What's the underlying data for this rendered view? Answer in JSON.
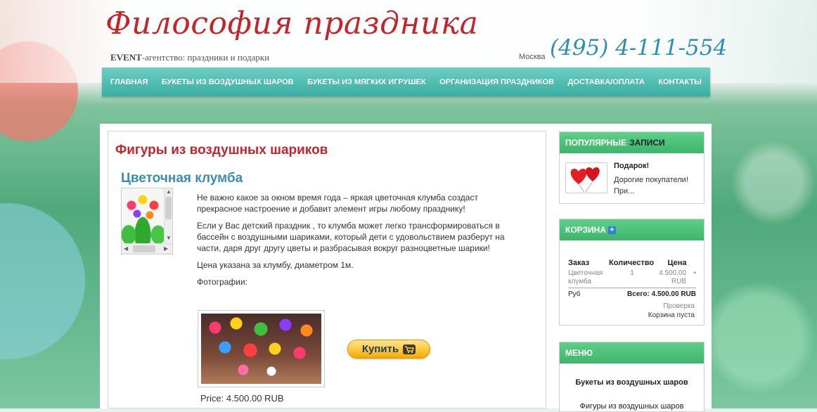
{
  "header": {
    "logo_title": "Философия праздника",
    "logo_sub_bold": "EVENT",
    "logo_sub_rest": "-агентство: праздники и подарки",
    "phone_city": "Москва",
    "phone_number": "(495) 4-111-554"
  },
  "nav": {
    "items": [
      "ГЛАВНАЯ",
      "БУКЕТЫ ИЗ ВОЗДУШНЫХ ШАРОВ",
      "БУКЕТЫ ИЗ МЯГКИХ ИГРУШЕК",
      "ОРГАНИЗАЦИЯ ПРАЗДНИКОВ",
      "ДОСТАВКА/ОПЛАТА",
      "КОНТАКТЫ"
    ]
  },
  "content": {
    "category_title": "Фигуры из воздушных шариков",
    "article_title": "Цветочная клумба",
    "paragraphs": [
      "Не важно какое за окном время года – яркая цветочная клумба создаст прекрасное настроение и добавит элемент игры любому празднику!",
      "Если у Вас детский праздник , то клумба может легко трансформироваться в бассейн с воздушными шариками, который дети с удовольствием разберут на части, даря друг другу цветы и разбрасывая вокруг разноцветные шарики!",
      "Цена указана за клумбу, диаметром 1м.",
      "Фотографии:"
    ],
    "buy_label": "Купить",
    "price": "Price: 4.500.00 RUB"
  },
  "popular": {
    "title_part1": "ПОПУЛЯРНЫЕ",
    "title_part2": "ЗАПИСИ",
    "item_title": "Подарок!",
    "item_desc": "Дорогие покупатели! При..."
  },
  "cart": {
    "title": "КОРЗИНА",
    "plus": "+",
    "headers": [
      "Заказ",
      "Количество",
      "Цена"
    ],
    "row": {
      "name": "Цветочная клумба",
      "qty": "1",
      "price": "4.500.00 RUB"
    },
    "total_currency": "Руб",
    "total": "Всего: 4.500.00 RUB",
    "check": "Проверка",
    "empty": "Корзина пуста"
  },
  "menu": {
    "title": "МЕНЮ",
    "items": [
      "Букеты из воздушных шаров",
      "Фигуры из воздушных шаров"
    ]
  },
  "colors": {
    "accent_red": "#c0262b",
    "title_blue": "#3a8db0",
    "nav_teal": "#3aaea2",
    "module_green": "#3db56b",
    "phone_blue": "#2d8fb5"
  }
}
